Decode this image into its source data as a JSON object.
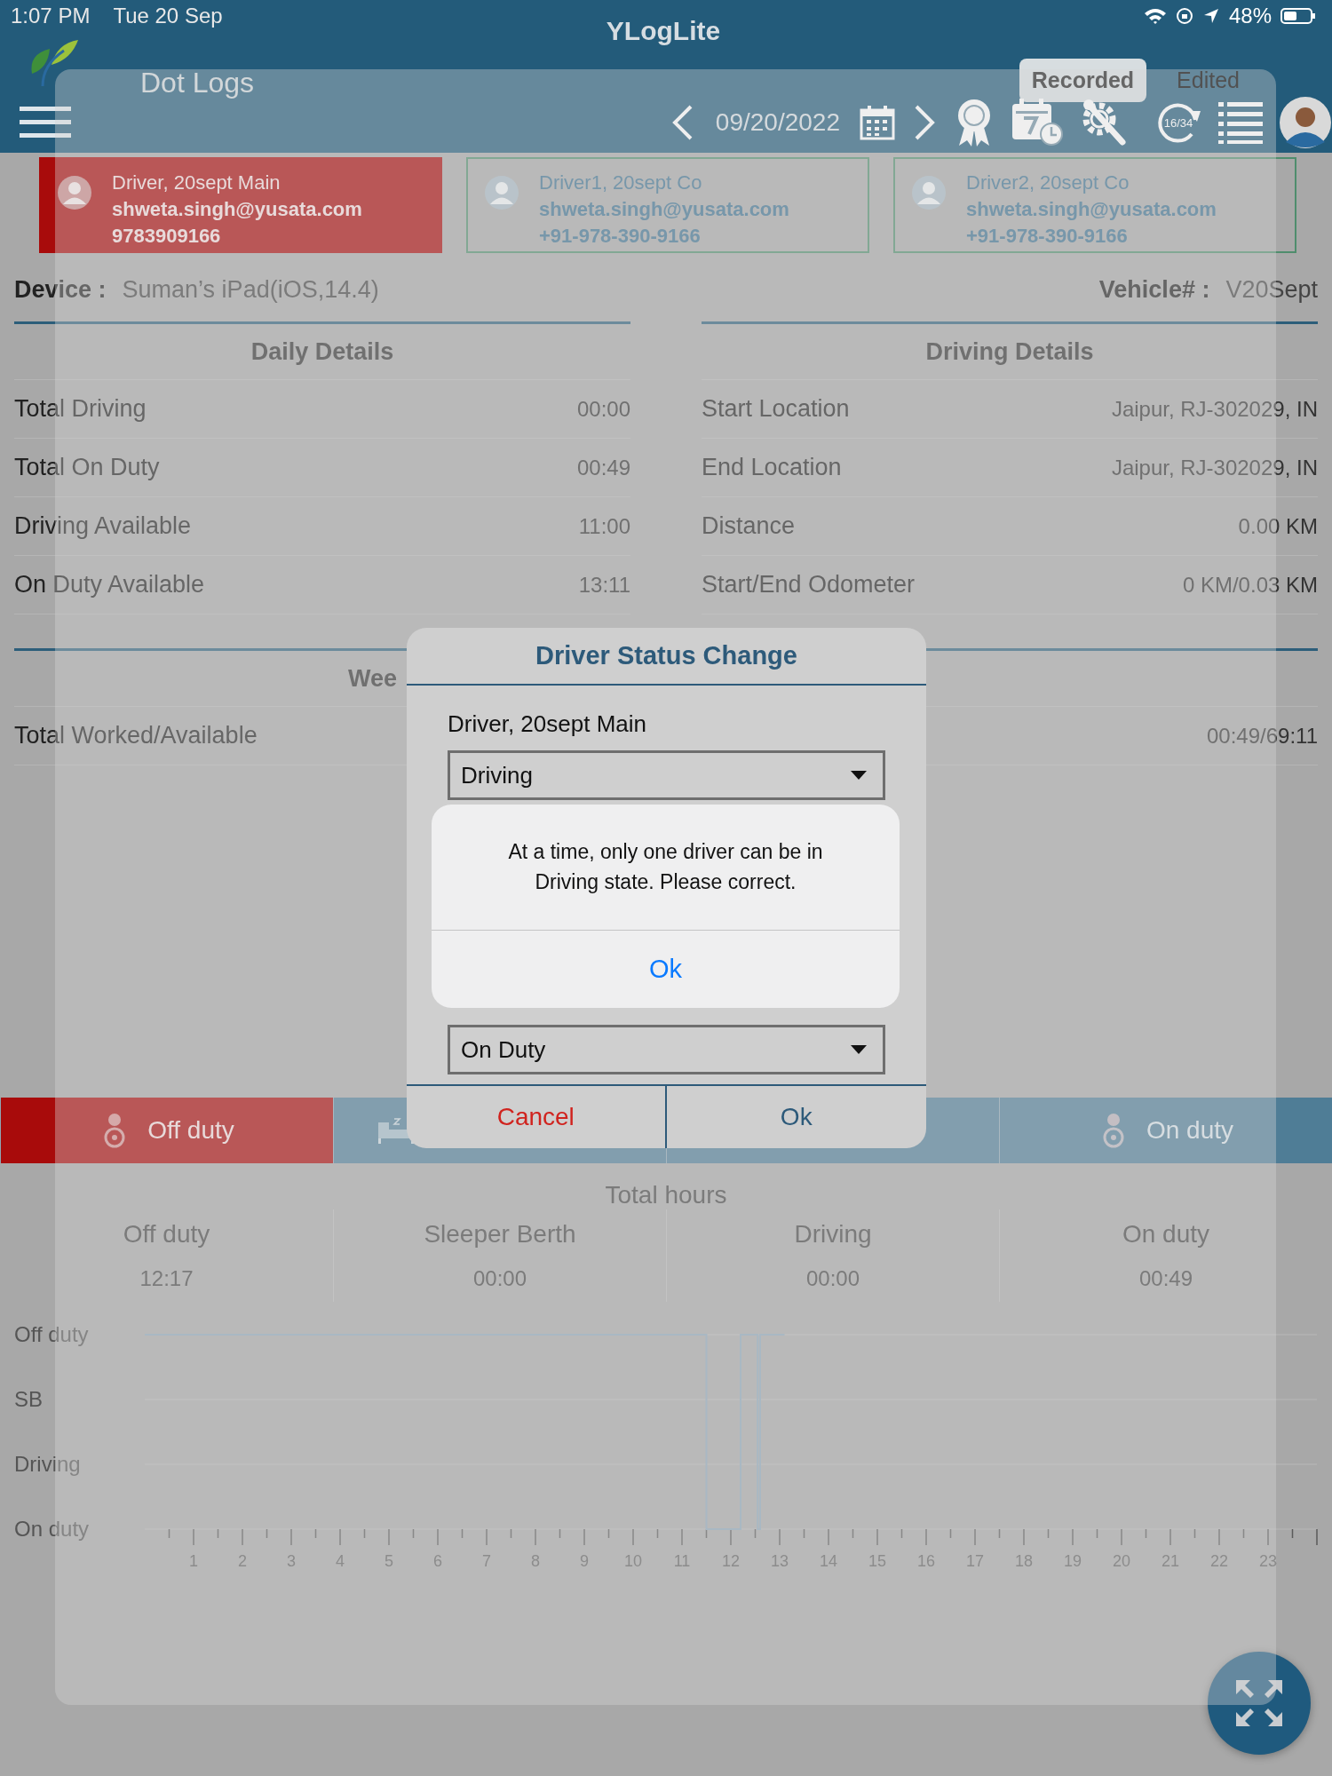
{
  "status_bar": {
    "time": "1:07 PM",
    "date": "Tue 20 Sep",
    "battery": "48%"
  },
  "app_title": "YLogLite",
  "page_title": "Dot Logs",
  "view_toggle": [
    {
      "label": "Recorded",
      "selected": true
    },
    {
      "label": "Edited",
      "selected": false
    }
  ],
  "date_nav": {
    "date": "09/20/2022"
  },
  "toolbar": {
    "cycle_badge": "16/34"
  },
  "drivers": [
    {
      "name": "Driver, 20sept Main",
      "email": "shweta.singh@yusata.com",
      "phone": "9783909166",
      "selected": true
    },
    {
      "name": "Driver1, 20sept Co",
      "email": "shweta.singh@yusata.com",
      "phone": "+91-978-390-9166",
      "selected": false
    },
    {
      "name": "Driver2, 20sept Co",
      "email": "shweta.singh@yusata.com",
      "phone": "+91-978-390-9166",
      "selected": false
    }
  ],
  "device": {
    "label": "Device :",
    "value": "Suman’s iPad(iOS,14.4)"
  },
  "vehicle": {
    "label": "Vehicle# :",
    "value": "V20Sept"
  },
  "daily_details": {
    "title": "Daily Details",
    "rows": [
      {
        "label": "Total Driving",
        "value": "00:00"
      },
      {
        "label": "Total On Duty",
        "value": "00:49"
      },
      {
        "label": "Driving Available",
        "value": "11:00"
      },
      {
        "label": "On Duty Available",
        "value": "13:11"
      }
    ]
  },
  "driving_details": {
    "title": "Driving Details",
    "rows": [
      {
        "label": "Start Location",
        "value": "Jaipur, RJ-302029, IN"
      },
      {
        "label": "End Location",
        "value": "Jaipur, RJ-302029, IN"
      },
      {
        "label": "Distance",
        "value": "0.00 KM"
      },
      {
        "label": "Start/End Odometer",
        "value": "0 KM/0.03 KM"
      }
    ]
  },
  "weekly_details": {
    "title": "Wee",
    "rows": [
      {
        "label": "Total Worked/Available",
        "value": "00:49/69:11"
      }
    ]
  },
  "status_tabs": [
    {
      "kind": "off",
      "label": "Off duty",
      "selected": true
    },
    {
      "kind": "sleeper",
      "selected": false
    },
    {
      "kind": "driving",
      "selected": false
    },
    {
      "kind": "on",
      "label": "On duty",
      "selected": false
    }
  ],
  "total_hours": {
    "title": "Total hours",
    "columns": [
      {
        "label": "Off duty",
        "value": "12:17"
      },
      {
        "label": "Sleeper Berth",
        "value": "00:00"
      },
      {
        "label": "Driving",
        "value": "00:00"
      },
      {
        "label": "On duty",
        "value": "00:49"
      }
    ]
  },
  "log_chart": {
    "row_labels": [
      "Off duty",
      "SB",
      "Driving",
      "On duty"
    ],
    "hour_labels": [
      "1",
      "2",
      "3",
      "4",
      "5",
      "6",
      "7",
      "8",
      "9",
      "10",
      "11",
      "12",
      "13",
      "14",
      "15",
      "16",
      "17",
      "18",
      "19",
      "20",
      "21",
      "22",
      "23"
    ]
  },
  "dialog": {
    "title": "Driver Status Change",
    "entries": [
      {
        "driver": "Driver, 20sept Main",
        "status": "Driving"
      },
      {
        "status": "On Duty"
      }
    ],
    "buttons": [
      {
        "kind": "cancel",
        "label": "Cancel"
      },
      {
        "kind": "ok",
        "label": "Ok"
      }
    ]
  },
  "alert": {
    "message": "At a time, only one driver can be in Driving state. Please correct.",
    "button": "Ok"
  }
}
